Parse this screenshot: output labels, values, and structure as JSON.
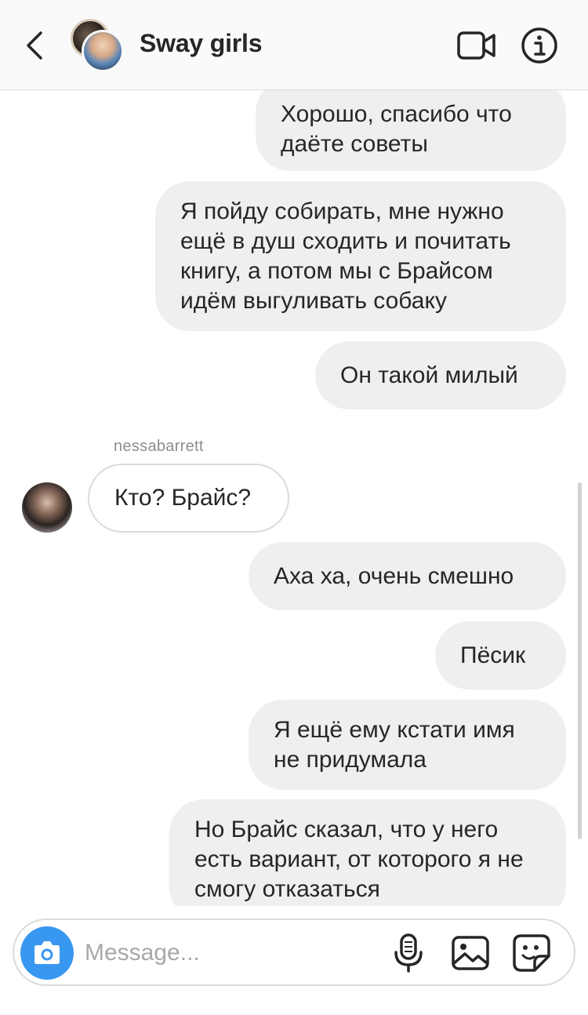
{
  "header": {
    "title": "Sway girls",
    "back_icon": "chevron-left-icon",
    "video_icon": "video-camera-icon",
    "info_icon": "info-icon"
  },
  "messages": [
    {
      "from": "me",
      "text": "Хорошо, спасибо что даёте советы"
    },
    {
      "from": "me",
      "text": "Я пойду собирать, мне нужно ещё в душ сходить и почитать книгу, а потом мы с Брайсом идём выгуливать собаку"
    },
    {
      "from": "me",
      "text": "Он такой милый"
    },
    {
      "from": "other",
      "sender": "nessabarrett",
      "text": "Кто? Брайс?"
    },
    {
      "from": "me",
      "text": "Аха ха, очень смешно"
    },
    {
      "from": "me",
      "text": "Пёсик"
    },
    {
      "from": "me",
      "text": "Я ещё ему кстати имя не придумала"
    },
    {
      "from": "me",
      "text": "Но Брайс сказал, что у  него есть вариант, от которого я не смогу отказаться"
    }
  ],
  "composer": {
    "placeholder": "Message...",
    "camera_icon": "camera-icon",
    "mic_icon": "microphone-icon",
    "gallery_icon": "image-gallery-icon",
    "sticker_icon": "sticker-icon"
  },
  "colors": {
    "accent": "#3897f0",
    "bubble_outgoing": "#efefef",
    "bubble_incoming_border": "#dbdbdb",
    "text": "#262626",
    "muted": "#8e8e8e"
  }
}
